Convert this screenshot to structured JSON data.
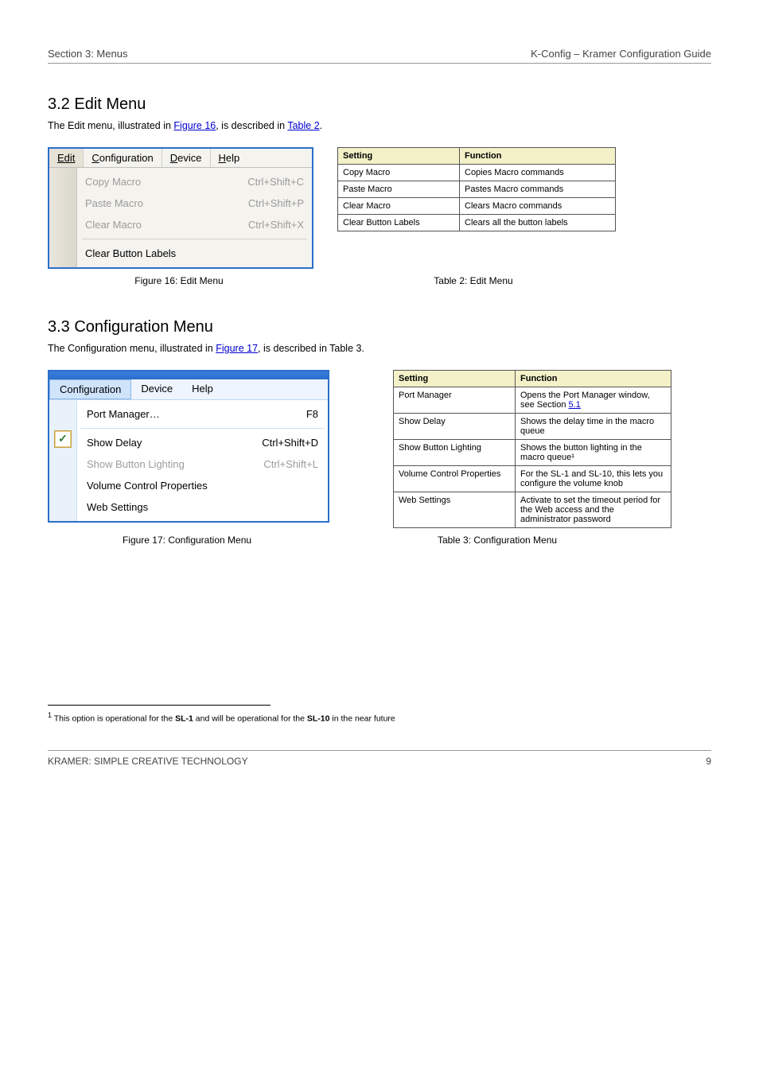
{
  "header": {
    "left": "Section 3: Menus",
    "right": "K-Config – Kramer Configuration Guide"
  },
  "edit_section": {
    "title": "3.2 Edit Menu",
    "desc_pre": "The Edit menu, illustrated in ",
    "desc_link": "Figure 16",
    "desc_mid": ", is described in ",
    "desc_link2": "Table 2",
    "desc_post": ".",
    "caption": "Figure 16: Edit Menu",
    "caption2": "Table 2: Edit Menu",
    "menubar": {
      "edit": "Edit",
      "configuration": "Configuration",
      "device": "Device",
      "help": "Help"
    },
    "rows": [
      {
        "label": "Copy Macro",
        "shortcut": "Ctrl+Shift+C"
      },
      {
        "label": "Paste Macro",
        "shortcut": "Ctrl+Shift+P"
      },
      {
        "label": "Clear Macro",
        "shortcut": "Ctrl+Shift+X"
      }
    ],
    "enabled_row": {
      "label": "Clear Button Labels"
    }
  },
  "edit_table": {
    "headers": [
      "Setting",
      "Function"
    ],
    "rows": [
      [
        "Copy Macro",
        "Copies Macro commands"
      ],
      [
        "Paste Macro",
        "Pastes Macro commands"
      ],
      [
        "Clear Macro",
        "Clears Macro commands"
      ],
      [
        "Clear Button Labels",
        "Clears all the button labels"
      ]
    ]
  },
  "config_section": {
    "title": "3.3 Configuration Menu",
    "desc_pre": "The Configuration menu, illustrated in ",
    "desc_link": "Figure 17",
    "desc_mid": ", is described in ",
    "desc_plain": "Table 3",
    "desc_post": ".",
    "caption": "Figure 17: Configuration Menu",
    "caption2": "Table 3: Configuration Menu",
    "menubar": {
      "configuration": "Configuration",
      "device": "Device",
      "help": "Help"
    },
    "rows": [
      {
        "label": "Port Manager…",
        "shortcut": "F8",
        "disabled": false
      },
      {
        "label": "Show Delay",
        "shortcut": "Ctrl+Shift+D",
        "disabled": false,
        "checked": true
      },
      {
        "label": "Show Button Lighting",
        "shortcut": "Ctrl+Shift+L",
        "disabled": true
      },
      {
        "label": "Volume Control Properties",
        "shortcut": "",
        "disabled": false
      },
      {
        "label": "Web Settings",
        "shortcut": "",
        "disabled": false
      }
    ]
  },
  "config_table": {
    "headers": [
      "Setting",
      "Function"
    ],
    "rows": [
      {
        "c0": "Port Manager",
        "c1_pre": "Opens the Port Manager window, see Section ",
        "c1_link": "5.1"
      },
      {
        "c0": "Show Delay",
        "c1": "Shows the delay time in the macro queue"
      },
      {
        "c0": "Show Button Lighting",
        "c1": "Shows the button lighting in the macro queue¹"
      },
      {
        "c0": "Volume Control Properties",
        "c1": "For the SL-1 and SL-10, this lets you configure the volume knob"
      },
      {
        "c0": "Web Settings",
        "c1": "Activate to set the timeout period for the Web access and the administrator password"
      }
    ]
  },
  "footnote": {
    "marker": "1",
    "text_pre": " This option is operational for the ",
    "bold1": "SL-1",
    "mid": " and will be operational for the ",
    "bold2": "SL-10",
    "post": " in the near future"
  },
  "footer": {
    "left": "KRAMER: SIMPLE CREATIVE TECHNOLOGY",
    "right": "9"
  }
}
